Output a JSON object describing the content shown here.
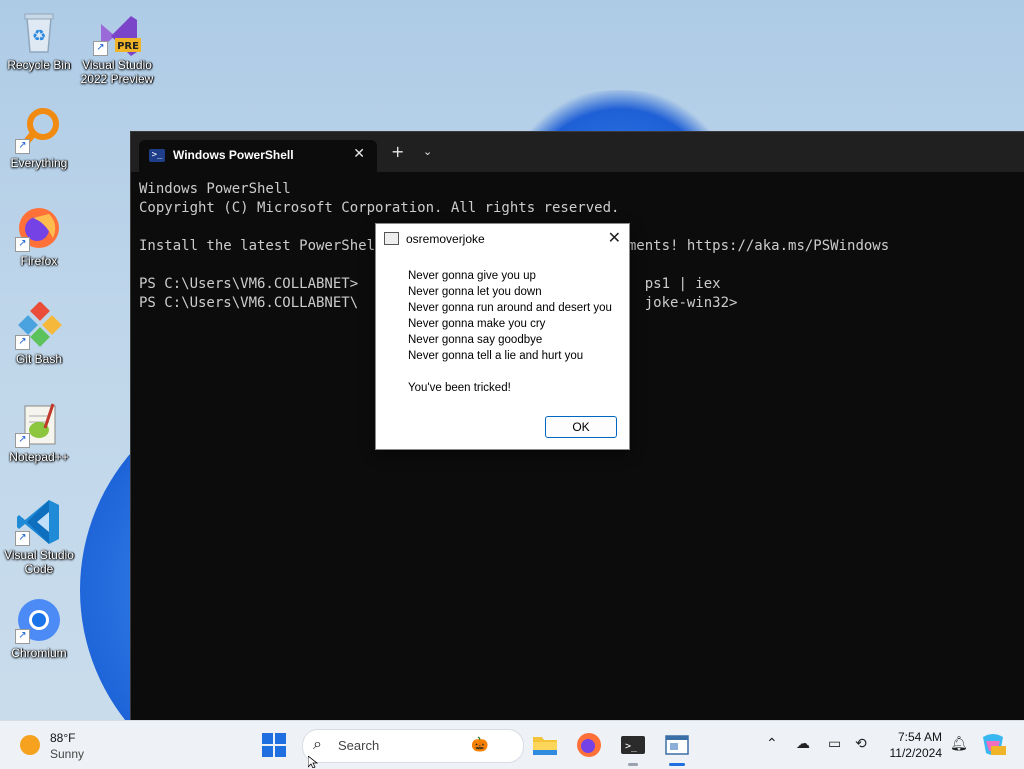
{
  "desktop": {
    "icons": [
      {
        "label": "Recycle Bin",
        "name": "recycle-bin"
      },
      {
        "label": "Visual Studio 2022 Preview",
        "name": "visual-studio-2022-preview",
        "badge": "PRE"
      },
      {
        "label": "Everything",
        "name": "everything"
      },
      {
        "label": "Firefox",
        "name": "firefox"
      },
      {
        "label": "Git Bash",
        "name": "git-bash"
      },
      {
        "label": "Notepad++",
        "name": "notepad-plus-plus"
      },
      {
        "label": "Visual Studio Code",
        "name": "visual-studio-code"
      },
      {
        "label": "Chromium",
        "name": "chromium"
      }
    ]
  },
  "terminal": {
    "tab_title": "Windows PowerShell",
    "lines": [
      "Windows PowerShell",
      "Copyright (C) Microsoft Corporation. All rights reserved.",
      "",
      "Install the latest PowerShell for new features and improvements! https://aka.ms/PSWindows",
      "",
      "PS C:\\Users\\VM6.COLLABNET>                                  ps1 | iex",
      "PS C:\\Users\\VM6.COLLABNET\\                                  joke-win32>"
    ]
  },
  "dialog": {
    "title": "osremoverjoke",
    "message_lines": [
      "Never gonna give you up",
      "Never gonna let you down",
      "Never gonna run around and desert you",
      "Never gonna make you cry",
      "Never gonna say goodbye",
      "Never gonna tell a lie and hurt you",
      "",
      "You've been tricked!"
    ],
    "ok_label": "OK"
  },
  "taskbar": {
    "weather": {
      "temp": "88°F",
      "condition": "Sunny"
    },
    "search_placeholder": "Search",
    "clock": {
      "time": "7:54 AM",
      "date": "11/2/2024"
    },
    "accent": "#1f6fe0"
  }
}
